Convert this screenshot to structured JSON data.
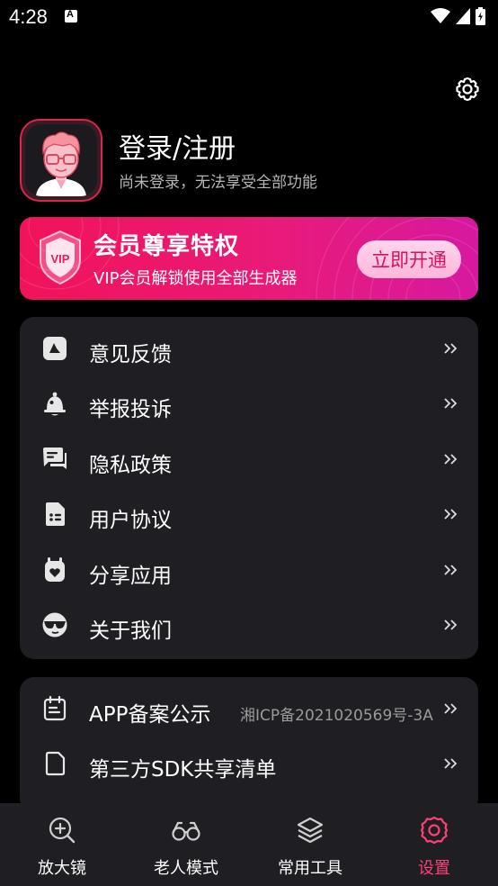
{
  "status_bar": {
    "time": "4:28"
  },
  "profile": {
    "title": "登录/注册",
    "subtitle": "尚未登录，无法享受全部功能"
  },
  "vip": {
    "title": "会员尊享特权",
    "subtitle": "VIP会员解锁使用全部生成器",
    "button_label": "立即开通",
    "badge_text": "VIP",
    "gradient": [
      "#f1135a",
      "#e91a78",
      "#d719a0"
    ]
  },
  "menu": {
    "items": [
      {
        "label": "意见反馈",
        "icon": "feedback-icon"
      },
      {
        "label": "举报投诉",
        "icon": "bell-icon"
      },
      {
        "label": "隐私政策",
        "icon": "chat-icon"
      },
      {
        "label": "用户协议",
        "icon": "document-icon"
      },
      {
        "label": "分享应用",
        "icon": "share-icon"
      },
      {
        "label": "关于我们",
        "icon": "sunglasses-icon"
      }
    ]
  },
  "info": {
    "items": [
      {
        "label": "APP备案公示",
        "value": "湘ICP备2021020569号-3A",
        "icon": "calendar-icon"
      },
      {
        "label": "第三方SDK共享清单",
        "value": "",
        "icon": "file-icon"
      }
    ]
  },
  "nav": {
    "items": [
      {
        "label": "放大镜",
        "icon": "magnifier-icon",
        "active": false
      },
      {
        "label": "老人模式",
        "icon": "glasses-icon",
        "active": false
      },
      {
        "label": "常用工具",
        "icon": "layers-icon",
        "active": false
      },
      {
        "label": "设置",
        "icon": "settings-icon",
        "active": true
      }
    ],
    "active_color": "#ff3f78"
  }
}
